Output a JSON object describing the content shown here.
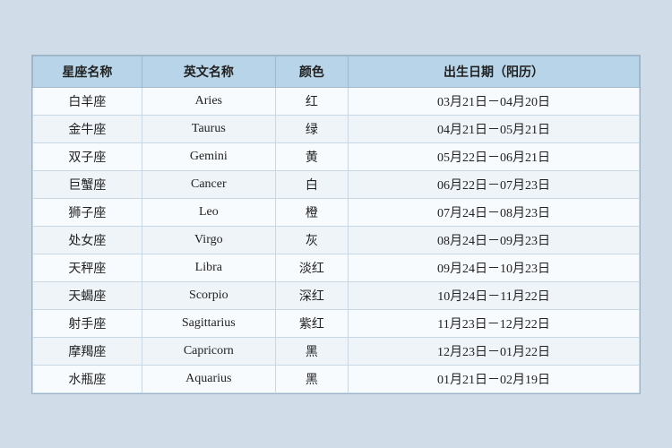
{
  "table": {
    "headers": [
      "星座名称",
      "英文名称",
      "颜色",
      "出生日期（阳历）"
    ],
    "rows": [
      {
        "zh": "白羊座",
        "en": "Aries",
        "color": "红",
        "date": "03月21日－04月20日"
      },
      {
        "zh": "金牛座",
        "en": "Taurus",
        "color": "绿",
        "date": "04月21日－05月21日"
      },
      {
        "zh": "双子座",
        "en": "Gemini",
        "color": "黄",
        "date": "05月22日－06月21日"
      },
      {
        "zh": "巨蟹座",
        "en": "Cancer",
        "color": "白",
        "date": "06月22日－07月23日"
      },
      {
        "zh": "狮子座",
        "en": "Leo",
        "color": "橙",
        "date": "07月24日－08月23日"
      },
      {
        "zh": "处女座",
        "en": "Virgo",
        "color": "灰",
        "date": "08月24日－09月23日"
      },
      {
        "zh": "天秤座",
        "en": "Libra",
        "color": "淡红",
        "date": "09月24日－10月23日"
      },
      {
        "zh": "天蝎座",
        "en": "Scorpio",
        "color": "深红",
        "date": "10月24日－11月22日"
      },
      {
        "zh": "射手座",
        "en": "Sagittarius",
        "color": "紫红",
        "date": "11月23日－12月22日"
      },
      {
        "zh": "摩羯座",
        "en": "Capricorn",
        "color": "黑",
        "date": "12月23日－01月22日"
      },
      {
        "zh": "水瓶座",
        "en": "Aquarius",
        "color": "黑",
        "date": "01月21日－02月19日"
      }
    ]
  }
}
